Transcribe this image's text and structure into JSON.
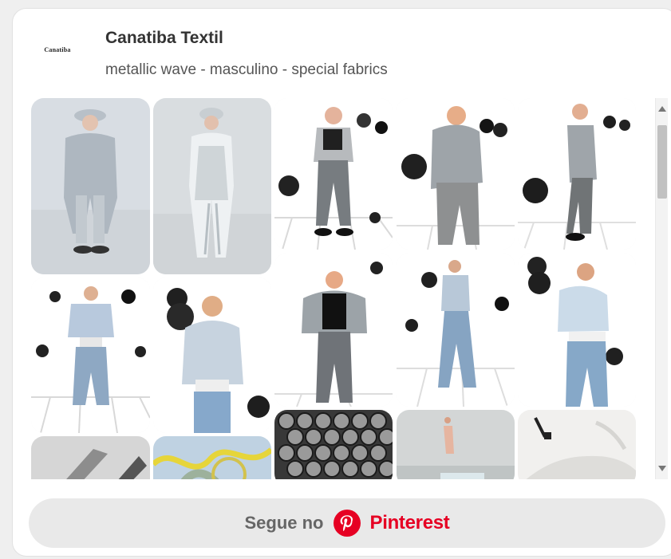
{
  "widget": {
    "logo_text": "Canatiba",
    "owner": "Canatiba Textil",
    "board": "metallic wave - masculino - special fabrics"
  },
  "pins": [
    {
      "name": "pin-metallic-coat-look"
    },
    {
      "name": "pin-silver-jacket-look"
    },
    {
      "name": "pin-silver-jeans-look"
    },
    {
      "name": "pin-back-jacket-look"
    },
    {
      "name": "pin-side-jacket-look"
    },
    {
      "name": "pin-denim-jacket-look"
    },
    {
      "name": "pin-light-blazer-look"
    },
    {
      "name": "pin-open-jacket-look"
    },
    {
      "name": "pin-walking-denim-look"
    },
    {
      "name": "pin-cropped-blazer-look"
    },
    {
      "name": "pin-metal-detail"
    },
    {
      "name": "pin-yellow-sculpture"
    },
    {
      "name": "pin-silver-spheres"
    },
    {
      "name": "pin-runway-pool"
    },
    {
      "name": "pin-white-room"
    }
  ],
  "follow": {
    "prefix": "Segue no",
    "brand": "Pinterest"
  },
  "colors": {
    "brand": "#e60023",
    "button_bg": "#e9e9e9"
  },
  "icons": {
    "pinterest": "pinterest-icon",
    "scroll_up": "scroll-up-arrow-icon",
    "scroll_down": "scroll-down-arrow-icon"
  }
}
